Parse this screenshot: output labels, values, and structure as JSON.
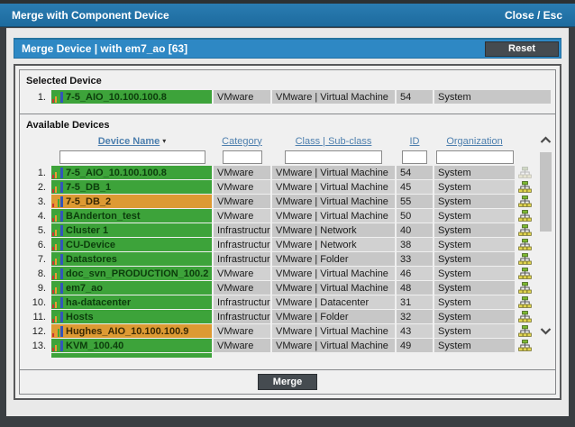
{
  "window": {
    "title": "Merge with Component Device",
    "close_label": "Close / Esc"
  },
  "header": {
    "title": "Merge Device | with em7_ao [63]",
    "reset_label": "Reset"
  },
  "selected_device": {
    "section_title": "Selected Device",
    "row": {
      "index": "1.",
      "name": "7-5_AIO_10.100.100.8",
      "category": "VMware",
      "device_class": "VMware | Virtual Machine",
      "id": "54",
      "organization": "System",
      "state": "green"
    }
  },
  "available_devices": {
    "section_title": "Available Devices",
    "columns": [
      {
        "label": "Device Name",
        "sort_indicator": "▾"
      },
      {
        "label": "Category"
      },
      {
        "label": "Class | Sub-class"
      },
      {
        "label": "ID"
      },
      {
        "label": "Organization"
      }
    ],
    "filters": {
      "values": [
        "",
        "",
        "",
        "",
        ""
      ]
    },
    "rows": [
      {
        "index": "1.",
        "name": "7-5_AIO_10.100.100.8",
        "category": "VMware",
        "device_class": "VMware | Virtual Machine",
        "id": "54",
        "organization": "System",
        "state": "green",
        "merge_icon_dimmed": true
      },
      {
        "index": "2.",
        "name": "7-5_DB_1",
        "category": "VMware",
        "device_class": "VMware | Virtual Machine",
        "id": "45",
        "organization": "System",
        "state": "green",
        "merge_icon_dimmed": false
      },
      {
        "index": "3.",
        "name": "7-5_DB_2",
        "category": "VMware",
        "device_class": "VMware | Virtual Machine",
        "id": "55",
        "organization": "System",
        "state": "orange",
        "merge_icon_dimmed": false
      },
      {
        "index": "4.",
        "name": "BAnderton_test",
        "category": "VMware",
        "device_class": "VMware | Virtual Machine",
        "id": "50",
        "organization": "System",
        "state": "green",
        "merge_icon_dimmed": false
      },
      {
        "index": "5.",
        "name": "Cluster 1",
        "category": "Infrastructure",
        "device_class": "VMware | Network",
        "id": "40",
        "organization": "System",
        "state": "green",
        "merge_icon_dimmed": false
      },
      {
        "index": "6.",
        "name": "CU-Device",
        "category": "Infrastructure",
        "device_class": "VMware | Network",
        "id": "38",
        "organization": "System",
        "state": "green",
        "merge_icon_dimmed": false
      },
      {
        "index": "7.",
        "name": "Datastores",
        "category": "Infrastructure",
        "device_class": "VMware | Folder",
        "id": "33",
        "organization": "System",
        "state": "green",
        "merge_icon_dimmed": false
      },
      {
        "index": "8.",
        "name": "doc_svn_PRODUCTION_100.2",
        "category": "VMware",
        "device_class": "VMware | Virtual Machine",
        "id": "46",
        "organization": "System",
        "state": "green",
        "merge_icon_dimmed": false
      },
      {
        "index": "9.",
        "name": "em7_ao",
        "category": "VMware",
        "device_class": "VMware | Virtual Machine",
        "id": "48",
        "organization": "System",
        "state": "green",
        "merge_icon_dimmed": false
      },
      {
        "index": "10.",
        "name": "ha-datacenter",
        "category": "Infrastructure",
        "device_class": "VMware | Datacenter",
        "id": "31",
        "organization": "System",
        "state": "green",
        "merge_icon_dimmed": false
      },
      {
        "index": "11.",
        "name": "Hosts",
        "category": "Infrastructure",
        "device_class": "VMware | Folder",
        "id": "32",
        "organization": "System",
        "state": "green",
        "merge_icon_dimmed": false
      },
      {
        "index": "12.",
        "name": "Hughes_AIO_10.100.100.9",
        "category": "VMware",
        "device_class": "VMware | Virtual Machine",
        "id": "43",
        "organization": "System",
        "state": "orange",
        "merge_icon_dimmed": false
      },
      {
        "index": "13.",
        "name": "KVM_100.40",
        "category": "VMware",
        "device_class": "VMware | Virtual Machine",
        "id": "49",
        "organization": "System",
        "state": "green",
        "merge_icon_dimmed": false
      }
    ],
    "has_partial_next_row": true
  },
  "footer": {
    "merge_label": "Merge"
  },
  "colors": {
    "titlebar_blue": "#2273a8",
    "subheader_blue": "#2e88c4",
    "button_charcoal": "#454b50",
    "row_green": "#3da33a",
    "row_orange": "#dd9a33",
    "cell_gray": "#c7c7c7",
    "link_blue": "#4d7fae"
  }
}
